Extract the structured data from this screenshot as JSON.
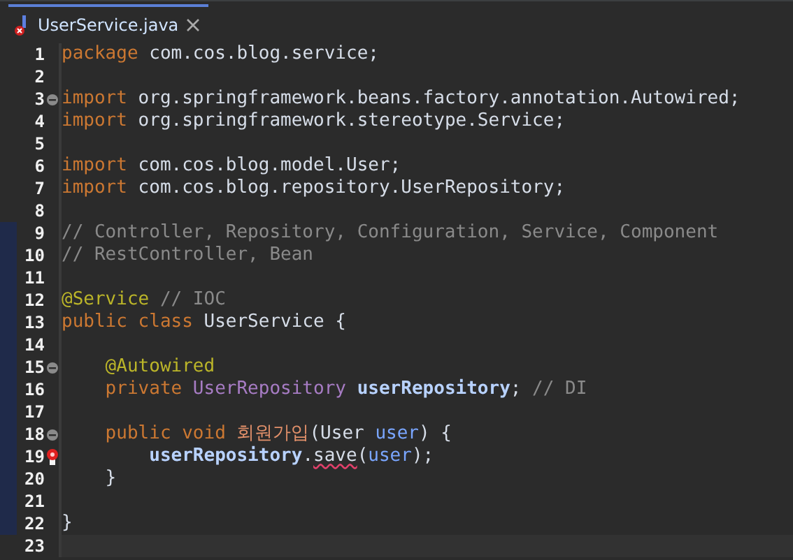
{
  "tab": {
    "title": "UserService.java",
    "selected": true,
    "has_error": true
  },
  "lines": [
    {
      "number": "1",
      "changed": false,
      "tokens": [
        {
          "text": "package",
          "kind": "keyword"
        },
        {
          "text": " com.cos.blog.service;",
          "kind": "plain"
        }
      ]
    },
    {
      "number": "2",
      "changed": false
    },
    {
      "number": "3",
      "changed": false,
      "fold": true,
      "tokens": [
        {
          "text": "import",
          "kind": "keyword"
        },
        {
          "text": " org.springframework.beans.factory.annotation.Autowired;",
          "kind": "plain"
        }
      ]
    },
    {
      "number": "4",
      "changed": false,
      "tokens": [
        {
          "text": "import",
          "kind": "keyword"
        },
        {
          "text": " org.springframework.stereotype.Service;",
          "kind": "plain"
        }
      ]
    },
    {
      "number": "5",
      "changed": false
    },
    {
      "number": "6",
      "changed": false,
      "tokens": [
        {
          "text": "import",
          "kind": "keyword"
        },
        {
          "text": " com.cos.blog.model.User;",
          "kind": "plain"
        }
      ]
    },
    {
      "number": "7",
      "changed": false,
      "tokens": [
        {
          "text": "import",
          "kind": "keyword"
        },
        {
          "text": " com.cos.blog.repository.UserRepository;",
          "kind": "plain"
        }
      ]
    },
    {
      "number": "8",
      "changed": false
    },
    {
      "number": "9",
      "changed": true,
      "tokens": [
        {
          "text": "// Controller, Repository, Configuration, Service, Component",
          "kind": "comment"
        }
      ]
    },
    {
      "number": "10",
      "changed": true,
      "tokens": [
        {
          "text": "// RestController, Bean",
          "kind": "comment"
        }
      ]
    },
    {
      "number": "11",
      "changed": true
    },
    {
      "number": "12",
      "changed": true,
      "tokens": [
        {
          "text": "@Service",
          "kind": "annotation"
        },
        {
          "text": " // IOC",
          "kind": "comment"
        }
      ]
    },
    {
      "number": "13",
      "changed": true,
      "tokens": [
        {
          "text": "public class",
          "kind": "keyword"
        },
        {
          "text": " UserService {",
          "kind": "plain"
        }
      ]
    },
    {
      "number": "14",
      "changed": true
    },
    {
      "number": "15",
      "changed": true,
      "fold": true,
      "tokens": [
        {
          "text": "    @Autowired",
          "kind": "annotation"
        }
      ]
    },
    {
      "number": "16",
      "changed": true,
      "tokens": [
        {
          "text": "    private",
          "kind": "keyword"
        },
        {
          "text": " UserRepository",
          "kind": "type"
        },
        {
          "text": " userRepository",
          "kind": "field"
        },
        {
          "text": ";",
          "kind": "plain"
        },
        {
          "text": " // DI",
          "kind": "comment"
        }
      ]
    },
    {
      "number": "17",
      "changed": true
    },
    {
      "number": "18",
      "changed": true,
      "fold": true,
      "tokens": [
        {
          "text": "    public void",
          "kind": "keyword"
        },
        {
          "text": " 회원가입",
          "kind": "method"
        },
        {
          "text": "(User ",
          "kind": "plain"
        },
        {
          "text": "user",
          "kind": "param"
        },
        {
          "text": ") {",
          "kind": "plain"
        }
      ]
    },
    {
      "number": "19",
      "changed": true,
      "breakpoint": true,
      "tokens": [
        {
          "text": "        userRepository",
          "kind": "field"
        },
        {
          "text": ".",
          "kind": "plain"
        },
        {
          "text": "save",
          "kind": "plain",
          "error": true
        },
        {
          "text": "(",
          "kind": "plain"
        },
        {
          "text": "user",
          "kind": "param"
        },
        {
          "text": ");",
          "kind": "plain"
        }
      ]
    },
    {
      "number": "20",
      "changed": true,
      "tokens": [
        {
          "text": "    }",
          "kind": "plain"
        }
      ]
    },
    {
      "number": "21",
      "changed": true
    },
    {
      "number": "22",
      "changed": true,
      "tokens": [
        {
          "text": "}",
          "kind": "plain"
        }
      ]
    },
    {
      "number": "23",
      "changed": false,
      "current": true
    }
  ]
}
